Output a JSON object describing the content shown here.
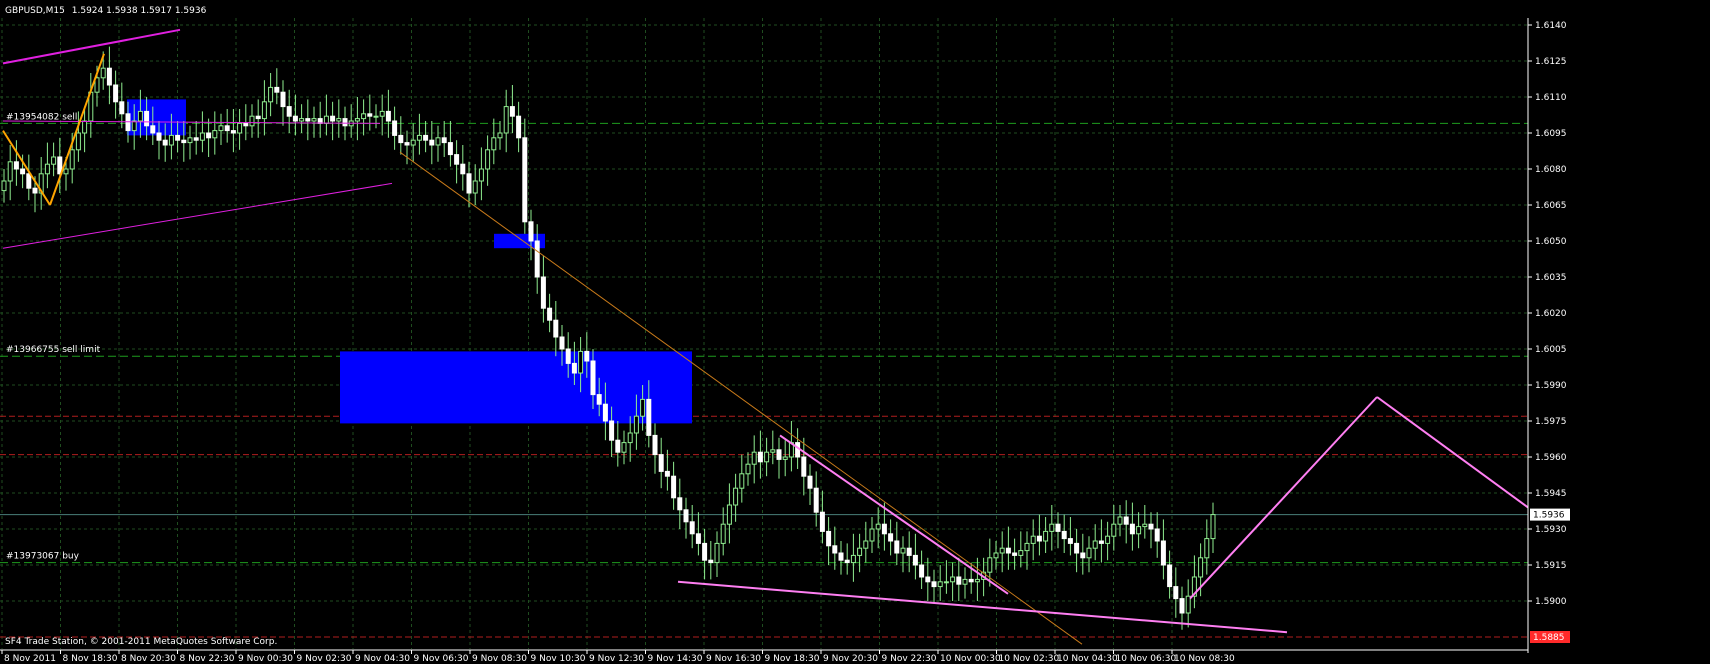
{
  "header": {
    "symbol_tf": "GBPUSD,M15",
    "ohlc": "1.5924 1.5938 1.5917 1.5936"
  },
  "footer": {
    "copyright": "SF4 Trade Station, © 2001-2011 MetaQuotes Software Corp."
  },
  "order_labels": [
    {
      "text": "#13954082 sell",
      "price": 1.6099
    },
    {
      "text": "#13966755 sell limit",
      "price": 1.6002
    },
    {
      "text": "#13973067 buy",
      "price": 1.5916
    }
  ],
  "colors": {
    "background": "#000000",
    "grid": "#1f4d1f",
    "bull_candle": "#ffffff",
    "bear_candle": "#ffffff",
    "candle_wick": "#90ee90",
    "order_line": "#1e9b1e",
    "stop_line": "#b01e1e",
    "blue_zone": "#0000ff",
    "magenta": "#e020e0",
    "pink": "#ff7ff2",
    "orange": "#ffa500",
    "dark_orange": "#c87a1a",
    "ask_line": "#4a7f7a",
    "axis": "#ffffff"
  },
  "chart_data": {
    "type": "candlestick",
    "symbol": "GBPUSD",
    "timeframe": "M15",
    "ylim": [
      1.588,
      1.615
    ],
    "y_ticks": [
      "1.6140",
      "1.6125",
      "1.6110",
      "1.6095",
      "1.6080",
      "1.6065",
      "1.6050",
      "1.6035",
      "1.6020",
      "1.6005",
      "1.5990",
      "1.5975",
      "1.5960",
      "1.5945",
      "1.5930",
      "1.5915",
      "1.5900"
    ],
    "x_ticks": [
      "8 Nov 2011",
      "8 Nov 18:30",
      "8 Nov 20:30",
      "8 Nov 22:30",
      "9 Nov 00:30",
      "9 Nov 02:30",
      "9 Nov 04:30",
      "9 Nov 06:30",
      "9 Nov 08:30",
      "9 Nov 10:30",
      "9 Nov 12:30",
      "9 Nov 14:30",
      "9 Nov 16:30",
      "9 Nov 18:30",
      "9 Nov 20:30",
      "9 Nov 22:30",
      "10 Nov 00:30",
      "10 Nov 02:30",
      "10 Nov 04:30",
      "10 Nov 06:30",
      "10 Nov 08:30"
    ],
    "current_price": "1.5936",
    "stop_price": "1.5885",
    "closes": [
      1.6075,
      1.6083,
      1.608,
      1.6078,
      1.6072,
      1.607,
      1.6078,
      1.6082,
      1.6085,
      1.6078,
      1.608,
      1.6088,
      1.6095,
      1.61,
      1.6112,
      1.6118,
      1.6122,
      1.6115,
      1.6108,
      1.6103,
      1.6096,
      1.61,
      1.6104,
      1.6098,
      1.6095,
      1.6092,
      1.609,
      1.6094,
      1.6092,
      1.6091,
      1.6093,
      1.6092,
      1.6095,
      1.6093,
      1.6096,
      1.6098,
      1.6096,
      1.6095,
      1.6099,
      1.6098,
      1.6102,
      1.6101,
      1.6108,
      1.6114,
      1.6112,
      1.6106,
      1.6102,
      1.61,
      1.6101,
      1.61,
      1.6101,
      1.6099,
      1.6102,
      1.61,
      1.6101,
      1.6098,
      1.61,
      1.6101,
      1.6103,
      1.6102,
      1.6102,
      1.6104,
      1.61,
      1.6094,
      1.6091,
      1.609,
      1.6092,
      1.6094,
      1.6092,
      1.609,
      1.6093,
      1.6091,
      1.6086,
      1.6082,
      1.6078,
      1.607,
      1.6075,
      1.608,
      1.6088,
      1.6093,
      1.6095,
      1.6106,
      1.6102,
      1.6093,
      1.6058,
      1.605,
      1.6035,
      1.6022,
      1.6017,
      1.601,
      1.6005,
      1.5999,
      1.5995,
      1.6004,
      1.6,
      1.5986,
      1.5982,
      1.5975,
      1.5967,
      1.5962,
      1.5966,
      1.597,
      1.5977,
      1.5984,
      1.5969,
      1.5961,
      1.5954,
      1.5952,
      1.5943,
      1.5938,
      1.5933,
      1.5928,
      1.5924,
      1.5917,
      1.5916,
      1.5924,
      1.5932,
      1.594,
      1.5947,
      1.5953,
      1.5957,
      1.5962,
      1.5958,
      1.5962,
      1.5963,
      1.5959,
      1.596,
      1.5966,
      1.596,
      1.5952,
      1.5947,
      1.5937,
      1.5929,
      1.5923,
      1.592,
      1.5917,
      1.5916,
      1.5919,
      1.5922,
      1.5925,
      1.593,
      1.5932,
      1.5928,
      1.5925,
      1.592,
      1.5922,
      1.5919,
      1.5915,
      1.591,
      1.5908,
      1.5906,
      1.5908,
      1.5908,
      1.591,
      1.5907,
      1.5909,
      1.5908,
      1.5909,
      1.5912,
      1.5918,
      1.592,
      1.5922,
      1.592,
      1.5919,
      1.5921,
      1.5924,
      1.5927,
      1.5925,
      1.5929,
      1.5932,
      1.5929,
      1.5926,
      1.5924,
      1.592,
      1.5918,
      1.5922,
      1.5925,
      1.5924,
      1.5927,
      1.5932,
      1.5935,
      1.5932,
      1.5928,
      1.5931,
      1.5932,
      1.593,
      1.5925,
      1.5915,
      1.5906,
      1.5901,
      1.5895,
      1.5902,
      1.591,
      1.5918,
      1.5926,
      1.5936
    ]
  }
}
